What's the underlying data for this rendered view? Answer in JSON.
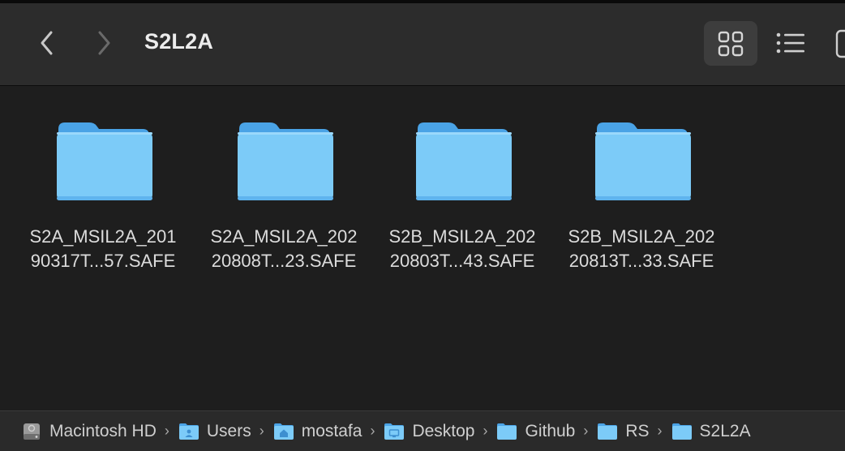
{
  "window": {
    "title": "S2L2A"
  },
  "toolbar": {
    "back_icon": "chevron-left-icon",
    "forward_icon": "chevron-right-icon",
    "view_modes": [
      "icon-grid-icon",
      "list-view-icon",
      "column-view-icon"
    ],
    "active_view": "icon-grid-icon"
  },
  "items": [
    {
      "line1": "S2A_MSIL2A_201",
      "line2": "90317T...57.SAFE",
      "icon": "folder-icon"
    },
    {
      "line1": "S2A_MSIL2A_202",
      "line2": "20808T...23.SAFE",
      "icon": "folder-icon"
    },
    {
      "line1": "S2B_MSIL2A_202",
      "line2": "20803T...43.SAFE",
      "icon": "folder-icon"
    },
    {
      "line1": "S2B_MSIL2A_202",
      "line2": "20813T...33.SAFE",
      "icon": "folder-icon"
    }
  ],
  "pathbar": {
    "crumbs": [
      {
        "label": "Macintosh HD",
        "icon": "hard-drive-icon"
      },
      {
        "label": "Users",
        "icon": "users-folder-icon"
      },
      {
        "label": "mostafa",
        "icon": "home-folder-icon"
      },
      {
        "label": "Desktop",
        "icon": "desktop-folder-icon"
      },
      {
        "label": "Github",
        "icon": "folder-icon"
      },
      {
        "label": "RS",
        "icon": "folder-icon"
      },
      {
        "label": "S2L2A",
        "icon": "folder-icon"
      }
    ],
    "separator": "›"
  },
  "colors": {
    "folder_front": "#7ccbf8",
    "folder_back": "#4aa3e6",
    "toolbar_bg": "#2c2c2c",
    "content_bg": "#1e1e1e"
  }
}
